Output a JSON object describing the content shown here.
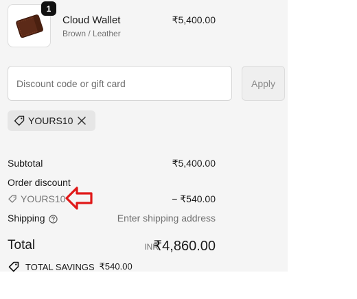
{
  "product": {
    "quantity": "1",
    "name": "Cloud Wallet",
    "variant": "Brown / Leather",
    "price": "₹5,400.00"
  },
  "discount_form": {
    "placeholder": "Discount code or gift card",
    "value": "",
    "apply_label": "Apply"
  },
  "applied_code_chip": {
    "code": "YOURS10"
  },
  "summary": {
    "subtotal_label": "Subtotal",
    "subtotal_value": "₹5,400.00",
    "order_discount_label": "Order discount",
    "discount_code": "YOURS10",
    "discount_value": "− ₹540.00",
    "shipping_label": "Shipping",
    "shipping_value": "Enter shipping address",
    "total_label": "Total",
    "total_currency": "INR",
    "total_value": "₹4,860.00",
    "savings_label": "TOTAL SAVINGS",
    "savings_value": "₹540.00"
  },
  "annotation": {
    "arrow_color": "#e01818"
  },
  "icons": [
    "wallet-image",
    "tag-icon",
    "close-icon",
    "help-icon",
    "arrow-icon"
  ]
}
